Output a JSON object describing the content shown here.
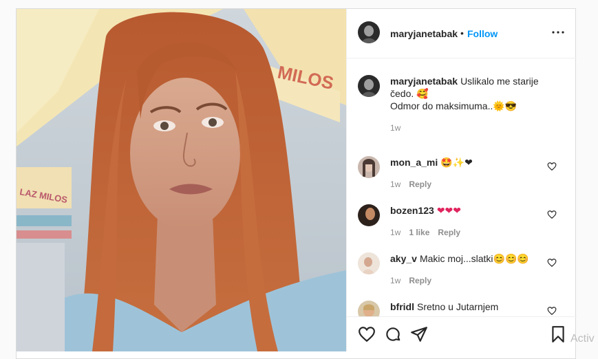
{
  "post": {
    "username": "maryjanetabak",
    "dot": "•",
    "follow_label": "Follow",
    "caption": {
      "username": "maryjanetabak",
      "line1": "Uslikalo me starije",
      "line2": "čedo. 🥰",
      "line3": "Odmor do maksimuma..🌞😎",
      "time": "1w"
    }
  },
  "comments": [
    {
      "username": "mon_a_mi",
      "text": "🤩✨❤",
      "time": "1w",
      "likes": "",
      "reply": "Reply"
    },
    {
      "username": "bozen123",
      "text": "❤❤❤",
      "time": "1w",
      "likes": "1 like",
      "reply": "Reply"
    },
    {
      "username": "aky_v",
      "text": "Makic moj...slatki😊😊😊",
      "time": "1w",
      "likes": "",
      "reply": "Reply"
    },
    {
      "username": "bfridl",
      "text": "Sretno u Jutarnjem",
      "time": "",
      "likes": "",
      "reply": ""
    }
  ],
  "photo_signs": {
    "sign1": "MILOS",
    "sign2": "LAZ MILOS"
  },
  "watermark": "Activ",
  "colors": {
    "follow": "#0095f6",
    "meta": "#8e8e8e",
    "border": "#dbdbdb"
  },
  "icons": [
    "more-options-icon",
    "heart-icon",
    "like-icon",
    "comment-icon",
    "share-icon",
    "bookmark-icon"
  ]
}
